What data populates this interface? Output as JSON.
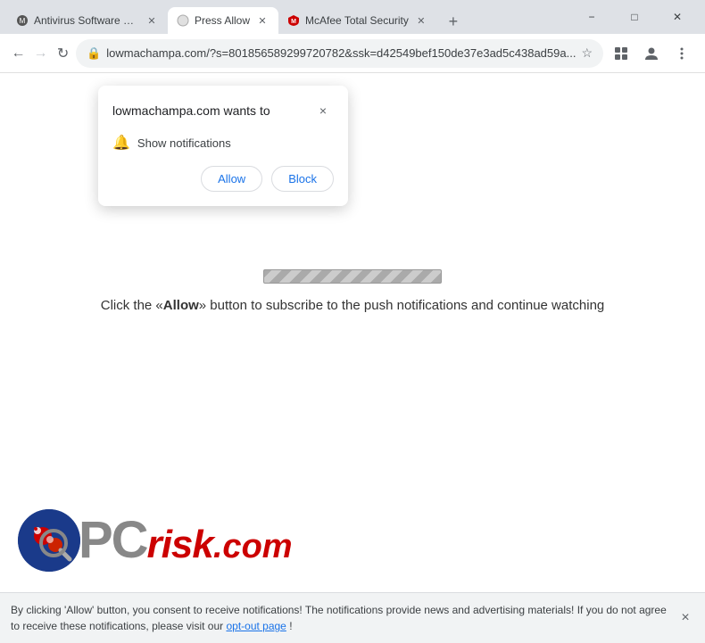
{
  "browser": {
    "tabs": [
      {
        "id": "tab-antivirus",
        "label": "Antivirus Software and Int...",
        "active": false,
        "favicon": "shield"
      },
      {
        "id": "tab-press-allow",
        "label": "Press Allow",
        "active": true,
        "favicon": "circle"
      },
      {
        "id": "tab-mcafee",
        "label": "McAfee Total Security",
        "active": false,
        "favicon": "mcafee"
      }
    ],
    "nav": {
      "back_disabled": false,
      "forward_disabled": true
    },
    "address_bar": {
      "url": "lowmachampa.com/?s=801856589299720782&ssk=d42549bef150de37e3ad5c438ad59a...",
      "lock_icon": "🔒"
    },
    "window_controls": {
      "minimize": "−",
      "maximize": "□",
      "close": "✕"
    }
  },
  "notification_popup": {
    "title": "lowmachampa.com wants to",
    "bell_label": "Show notifications",
    "allow_button": "Allow",
    "block_button": "Block",
    "close_button": "×"
  },
  "page": {
    "instruction_text": "Click the «Allow» button to subscribe to the push notifications and continue watching"
  },
  "pcrisk": {
    "text": "PC",
    "risk": "risk",
    "com": ".com"
  },
  "bottom_bar": {
    "text": "By clicking 'Allow' button, you consent to receive notifications! The notifications provide news and advertising materials! If you do not agree to receive these notifications, please visit our ",
    "link_text": "opt-out page",
    "text_after": "!",
    "close_button": "×"
  }
}
